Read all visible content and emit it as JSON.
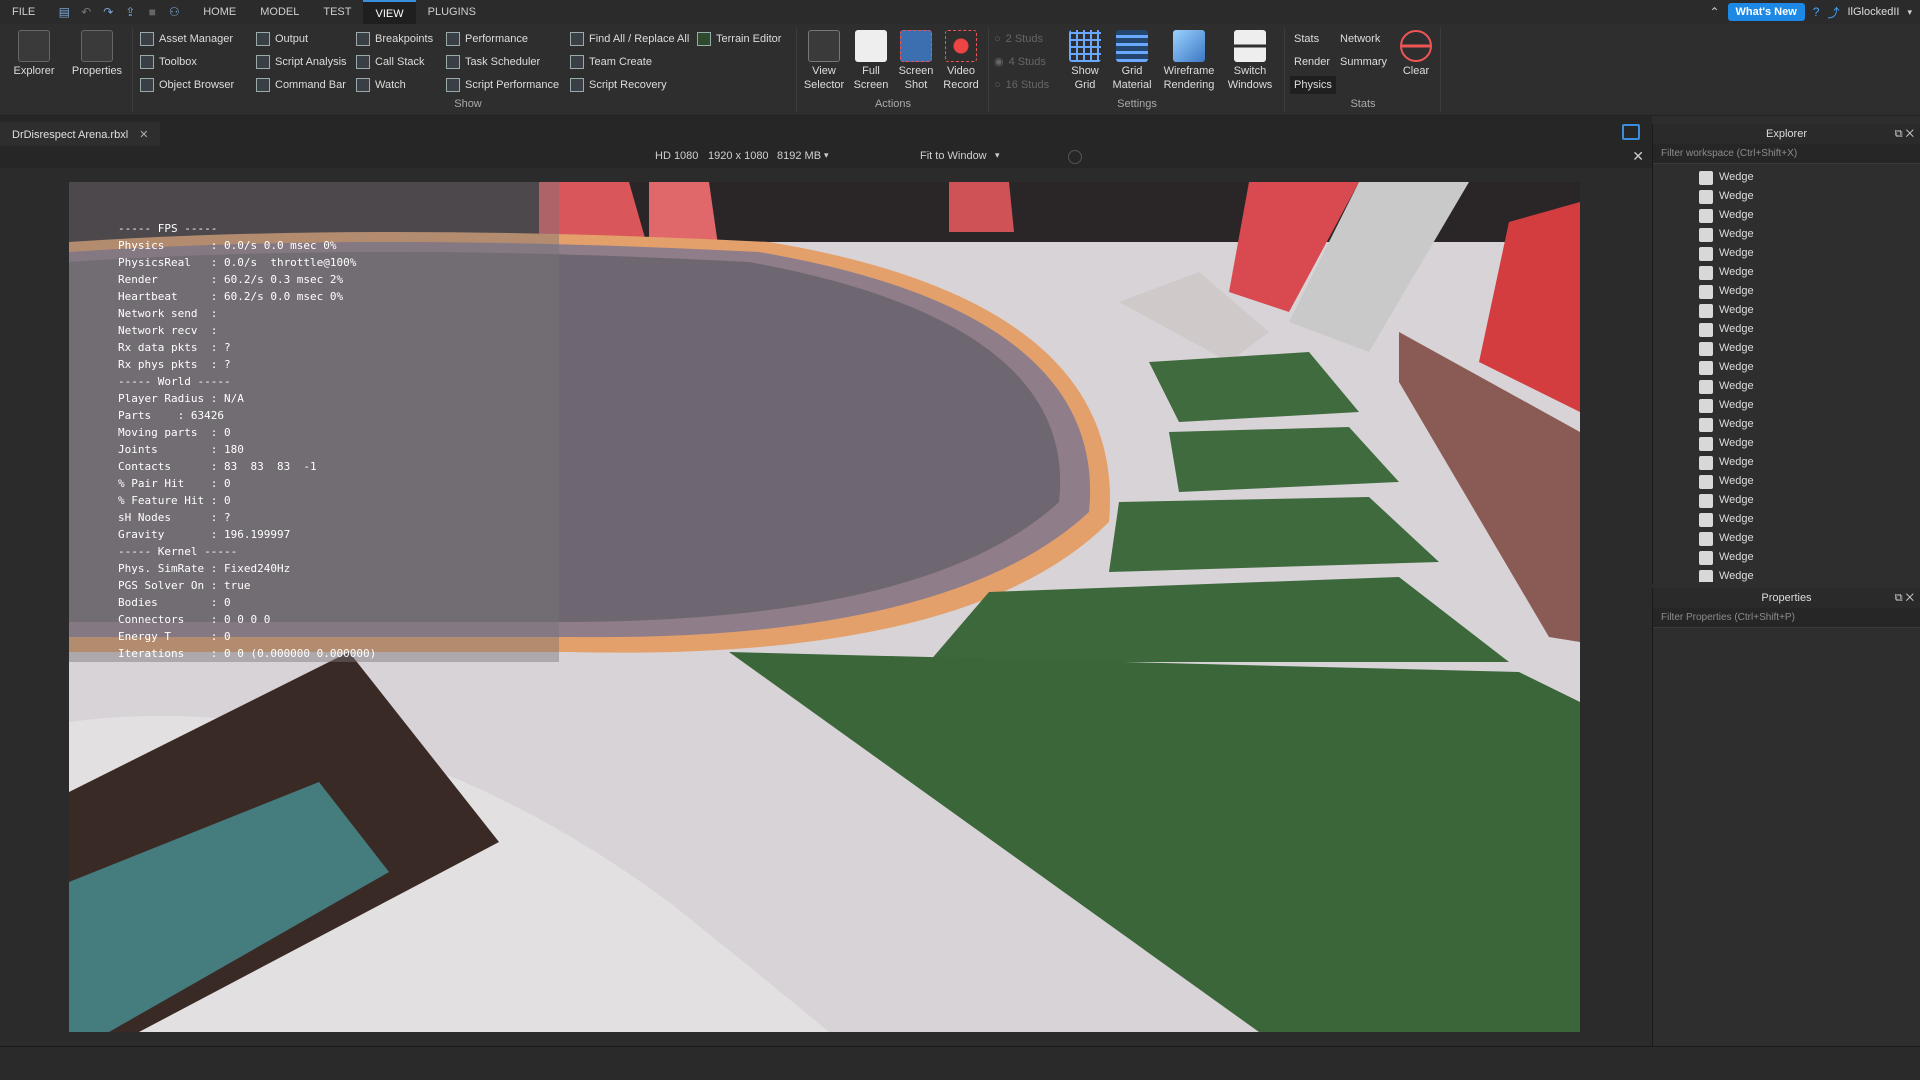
{
  "menubar": {
    "file": "FILE",
    "tabs": [
      "HOME",
      "MODEL",
      "TEST",
      "VIEW",
      "PLUGINS"
    ],
    "whats_new": "What's New",
    "user": "IlGlockedII"
  },
  "ribbon": {
    "explorer": "Explorer",
    "properties": "Properties",
    "show_col1": [
      "Asset Manager",
      "Toolbox",
      "Object Browser"
    ],
    "show_col2": [
      "Output",
      "Script Analysis",
      "Command Bar"
    ],
    "show_col3": [
      "Breakpoints",
      "Call Stack",
      "Watch"
    ],
    "show_col4": [
      "Performance",
      "Task Scheduler",
      "Script Performance"
    ],
    "show_col5": [
      "Find All / Replace All",
      "Team Create",
      "Script Recovery"
    ],
    "terrain_editor": "Terrain Editor",
    "show_label": "Show",
    "view_selector": [
      "View",
      "Selector"
    ],
    "full_screen": [
      "Full",
      "Screen"
    ],
    "screen_shot": [
      "Screen",
      "Shot"
    ],
    "video_record": [
      "Video",
      "Record"
    ],
    "actions_label": "Actions",
    "studs": [
      "2 Studs",
      "4 Studs",
      "16 Studs"
    ],
    "show_grid": [
      "Show",
      "Grid"
    ],
    "grid_material": [
      "Grid",
      "Material"
    ],
    "wireframe": [
      "Wireframe",
      "Rendering"
    ],
    "switch_windows": [
      "Switch",
      "Windows"
    ],
    "settings_label": "Settings",
    "stats_items": [
      "Stats",
      "Network",
      "Render",
      "Summary",
      "Physics"
    ],
    "clear": "Clear",
    "stats_label": "Stats"
  },
  "doc_tab": "DrDisrespect Arena.rbxl",
  "viewbar": {
    "resolution": "HD 1080",
    "size": "1920 x 1080",
    "memory": "8192 MB",
    "fit": "Fit to Window"
  },
  "stats_lines": [
    "----- FPS -----",
    "Physics       : 0.0/s 0.0 msec 0%",
    "PhysicsReal   : 0.0/s  throttle@100%",
    "Render        : 60.2/s 0.3 msec 2%",
    "Heartbeat     : 60.2/s 0.0 msec 0%",
    "Network send  :",
    "Network recv  :",
    "Rx data pkts  : ?",
    "Rx phys pkts  : ?",
    "----- World -----",
    "Player Radius : N/A",
    "Parts    : 63426",
    "Moving parts  : 0",
    "Joints        : 180",
    "Contacts      : 83  83  83  -1",
    "% Pair Hit    : 0",
    "% Feature Hit : 0",
    "sH Nodes      : ?",
    "Gravity       : 196.199997",
    "----- Kernel -----",
    "Phys. SimRate : Fixed240Hz",
    "PGS Solver On : true",
    "Bodies        : 0",
    "Connectors    : 0 0 0 0",
    "Energy T      : 0",
    "Iterations    : 0 0 (0.000000 0.000000)"
  ],
  "explorer": {
    "title": "Explorer",
    "filter": "Filter workspace (Ctrl+Shift+X)",
    "items": [
      "Wedge",
      "Wedge",
      "Wedge",
      "Wedge",
      "Wedge",
      "Wedge",
      "Wedge",
      "Wedge",
      "Wedge",
      "Wedge",
      "Wedge",
      "Wedge",
      "Wedge",
      "Wedge",
      "Wedge",
      "Wedge",
      "Wedge",
      "Wedge",
      "Wedge",
      "Wedge",
      "Wedge",
      "Wedge"
    ]
  },
  "properties": {
    "title": "Properties",
    "filter": "Filter Properties (Ctrl+Shift+P)"
  }
}
